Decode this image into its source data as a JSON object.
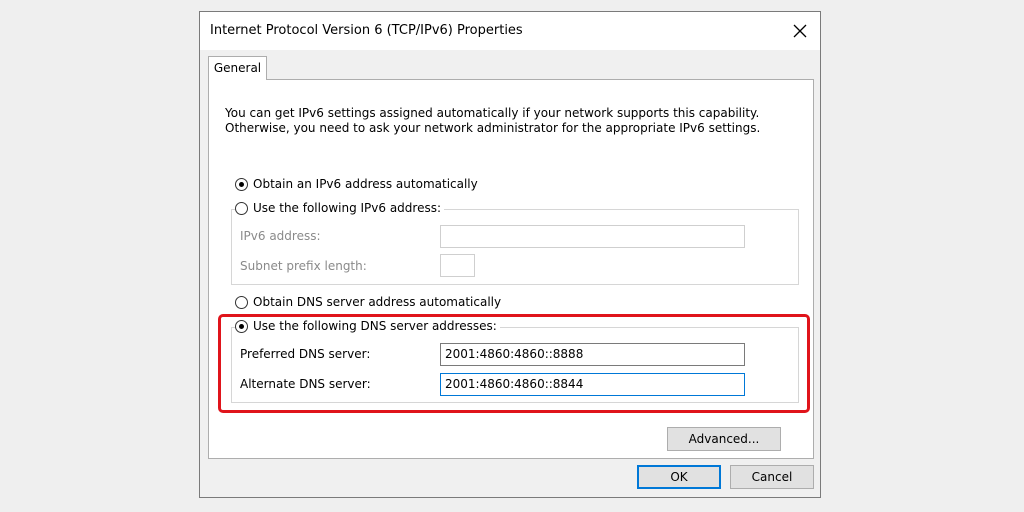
{
  "window": {
    "title": "Internet Protocol Version 6 (TCP/IPv6) Properties"
  },
  "tabs": [
    {
      "label": "General"
    }
  ],
  "general": {
    "description": "You can get IPv6 settings assigned automatically if your network supports this capability. Otherwise, you need to ask your network administrator for the appropriate IPv6 settings.",
    "ip": {
      "auto_label": "Obtain an IPv6 address automatically",
      "auto_selected": true,
      "manual_label": "Use the following IPv6 address:",
      "address_label": "IPv6 address:",
      "address_value": "",
      "prefix_label": "Subnet prefix length:",
      "prefix_value": ""
    },
    "dns": {
      "auto_label": "Obtain DNS server address automatically",
      "manual_label": "Use the following DNS server addresses:",
      "manual_selected": true,
      "preferred_label": "Preferred DNS server:",
      "preferred_value": "2001:4860:4860::8888",
      "alternate_label": "Alternate DNS server:",
      "alternate_value": "2001:4860:4860::8844"
    },
    "advanced_label": "Advanced..."
  },
  "footer": {
    "ok_label": "OK",
    "cancel_label": "Cancel"
  },
  "colors": {
    "highlight": "#e0141b",
    "accent": "#0078d7"
  }
}
